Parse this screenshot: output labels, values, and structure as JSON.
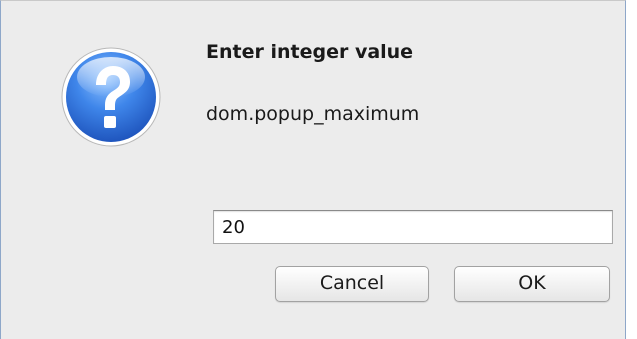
{
  "dialog": {
    "icon": "question-mark-icon",
    "title": "Enter integer value",
    "message": "dom.popup_maximum",
    "input_value": "20",
    "cancel_label": "Cancel",
    "ok_label": "OK"
  },
  "colors": {
    "dialog_background": "#ececec",
    "icon_blue": "#2f6fd6",
    "border_accent": "#8ea7c9"
  }
}
